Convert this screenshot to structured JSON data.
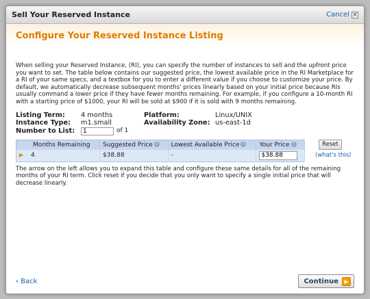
{
  "dialog": {
    "title": "Sell Your Reserved Instance",
    "cancel_label": "Cancel",
    "cancel_icon": "close-icon",
    "heading": "Configure Your Reserved Instance Listing",
    "intro": "When selling your Reserved Instance, (RI), you can specify the number of instances to sell and the upfront price you want to set. The table below contains our suggested price, the lowest available price in the RI Marketplace for a RI of your same specs, and a textbox for you to enter a different value if you choose to customize your price. By default, we automatically decrease subsequent months' prices linearly based on your initial price because RIs usually command a lower price if they have fewer months remaining. For example, if you configure a 10-month RI with a starting price of $1000, your RI will be sold at $900 if it is sold with 9 months remaining."
  },
  "details": {
    "listing_term_label": "Listing Term:",
    "listing_term_value": "4 months",
    "instance_type_label": "Instance Type:",
    "instance_type_value": "m1.small",
    "number_to_list_label": "Number to List:",
    "number_to_list_value": "1",
    "number_to_list_of": "of 1",
    "platform_label": "Platform:",
    "platform_value": "Linux/UNIX",
    "availability_zone_label": "Availability Zone:",
    "availability_zone_value": "us-east-1d"
  },
  "table": {
    "headers": [
      "Months Remaining",
      "Suggested Price",
      "Lowest Available Price",
      "Your Price"
    ],
    "rows": [
      {
        "months": "4",
        "suggested": "$38.88",
        "lowest": "-",
        "your_price": "$38.88"
      }
    ],
    "reset_label": "Reset",
    "whats_this_label": "(what's this)"
  },
  "note": "The arrow on the left allows you to expand this table and configure these same details for all of the remaining months of your RI term. Click reset if you decide that you only want to specify a single initial price that will decrease linearly.",
  "footer": {
    "back_label": "‹ Back",
    "continue_label": "Continue"
  },
  "colors": {
    "heading": "#e07b00",
    "link": "#1a5ea6",
    "table_bg": "#dde8f7",
    "table_header_bg": "#c6d6ee",
    "continue_arrow": "#f5a000"
  }
}
